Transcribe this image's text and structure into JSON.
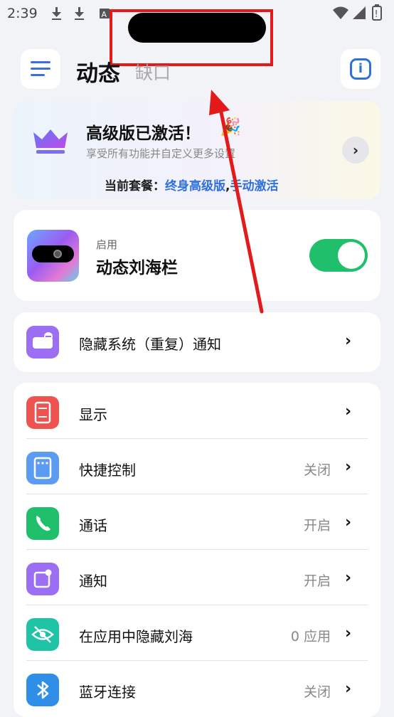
{
  "status_bar": {
    "time": "2:39"
  },
  "header": {
    "title": "动态",
    "subtitle": "缺口"
  },
  "premium": {
    "title": "高级版已激活！",
    "description": "享受所有功能并自定义更多设置",
    "plan_prefix": "当前套餐：",
    "plan_name": "终身高级版",
    "plan_activation": "手动激活"
  },
  "feature_toggle": {
    "state_label": "启用",
    "title": "动态刘海栏",
    "enabled": true,
    "switch_color": "#1fbf6b"
  },
  "hide_notifications": {
    "label": "隐藏系统（重复）通知",
    "icon": "hide-notification-icon"
  },
  "settings_list": [
    {
      "label": "显示",
      "value": "",
      "icon": "display-icon",
      "color": "#ef5350"
    },
    {
      "label": "快捷控制",
      "value": "关闭",
      "icon": "quick-control-icon",
      "color": "#5b9cf2"
    },
    {
      "label": "通话",
      "value": "开启",
      "icon": "phone-icon",
      "color": "#1fbf6b"
    },
    {
      "label": "通知",
      "value": "开启",
      "icon": "notification-icon",
      "color": "#9b6ef3"
    },
    {
      "label": "在应用中隐藏刘海",
      "value": "0 应用",
      "icon": "eye-off-icon",
      "color": "#1fc4a7"
    },
    {
      "label": "蓝牙连接",
      "value": "关闭",
      "icon": "bluetooth-icon",
      "color": "#2f8fe8"
    }
  ],
  "colors": {
    "accent": "#2f6fe0",
    "annotation": "#e41a1a",
    "background": "#f2f3f7"
  }
}
